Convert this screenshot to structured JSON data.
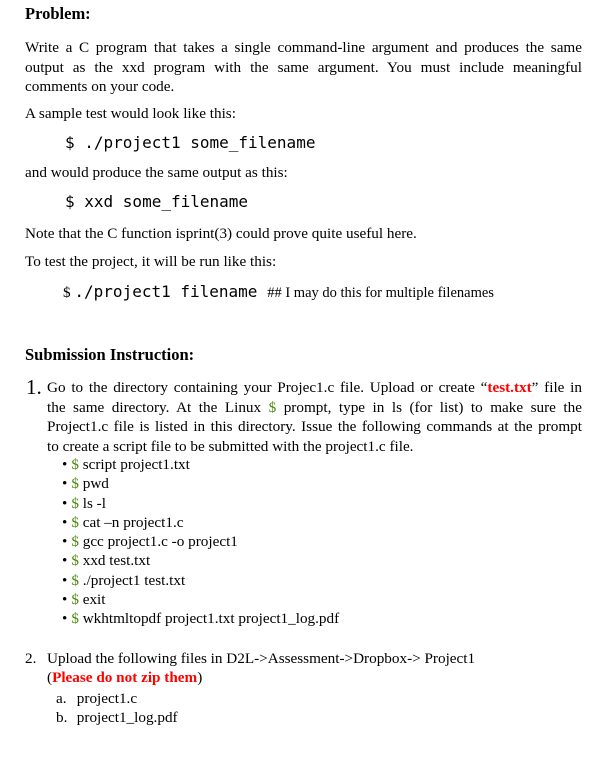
{
  "problem": {
    "heading": "Problem:",
    "intro_lines": [
      "Write a C program that takes a single command-line argument and produces the same",
      "output as the xxd program with the same argument. You must include meaningful",
      "comments on your code."
    ],
    "sample_intro": "A sample test would look like this:",
    "sample_command": "$ ./project1 some_filename",
    "output_intro": "and would produce the same output as this:",
    "xxd_command": "$ xxd some_filename",
    "note": "Note that the C function isprint(3) could prove quite useful here.",
    "run_intro": "To test the project, it will be run like this:",
    "run_prompt": "$",
    "run_command": "./project1 filename",
    "run_comment": "## I may do this for multiple filenames"
  },
  "submission": {
    "heading": "Submission Instruction:",
    "step1": {
      "number": "1.",
      "line1_before": "Go to the directory containing your Projec1.c file. Upload or create ",
      "line1_open_quote": "“",
      "line1_highlight": "test.txt",
      "line1_close_quote": "”",
      "line1_after": " file in",
      "line2_before": "the same directory. At the Linux ",
      "line2_prompt": "$",
      "line2_after": " prompt, type in ls (for list) to make sure the",
      "line3": "Project1.c file is listed in this directory. Issue the following commands at the prompt",
      "line4": "to create a script file to be submitted with the project1.c file.",
      "commands": [
        {
          "prompt": "$",
          "text": "script project1.txt"
        },
        {
          "prompt": "$",
          "text": "pwd"
        },
        {
          "prompt": "$",
          "text": "ls -l"
        },
        {
          "prompt": "$",
          "text": "cat –n project1.c"
        },
        {
          "prompt": "$",
          "text": "gcc project1.c -o project1"
        },
        {
          "prompt": "$",
          "text": "xxd test.txt"
        },
        {
          "prompt": "$",
          "text": "./project1  test.txt"
        },
        {
          "prompt": "$",
          "text": "exit"
        },
        {
          "prompt": "$",
          "text": "wkhtmltopdf project1.txt project1_log.pdf"
        }
      ],
      "bullet": "•"
    },
    "step2": {
      "number": "2.",
      "text": "Upload the following files in D2L->Assessment->Dropbox-> Project1",
      "paren_open": "(",
      "warning": "Please do not zip them",
      "paren_close": ")",
      "files": [
        {
          "letter": "a.",
          "name": "project1.c"
        },
        {
          "letter": "b.",
          "name": "project1_log.pdf"
        }
      ]
    }
  },
  "colors": {
    "prompt_green": "#4f8a10",
    "highlight_red": "#ff0000"
  }
}
